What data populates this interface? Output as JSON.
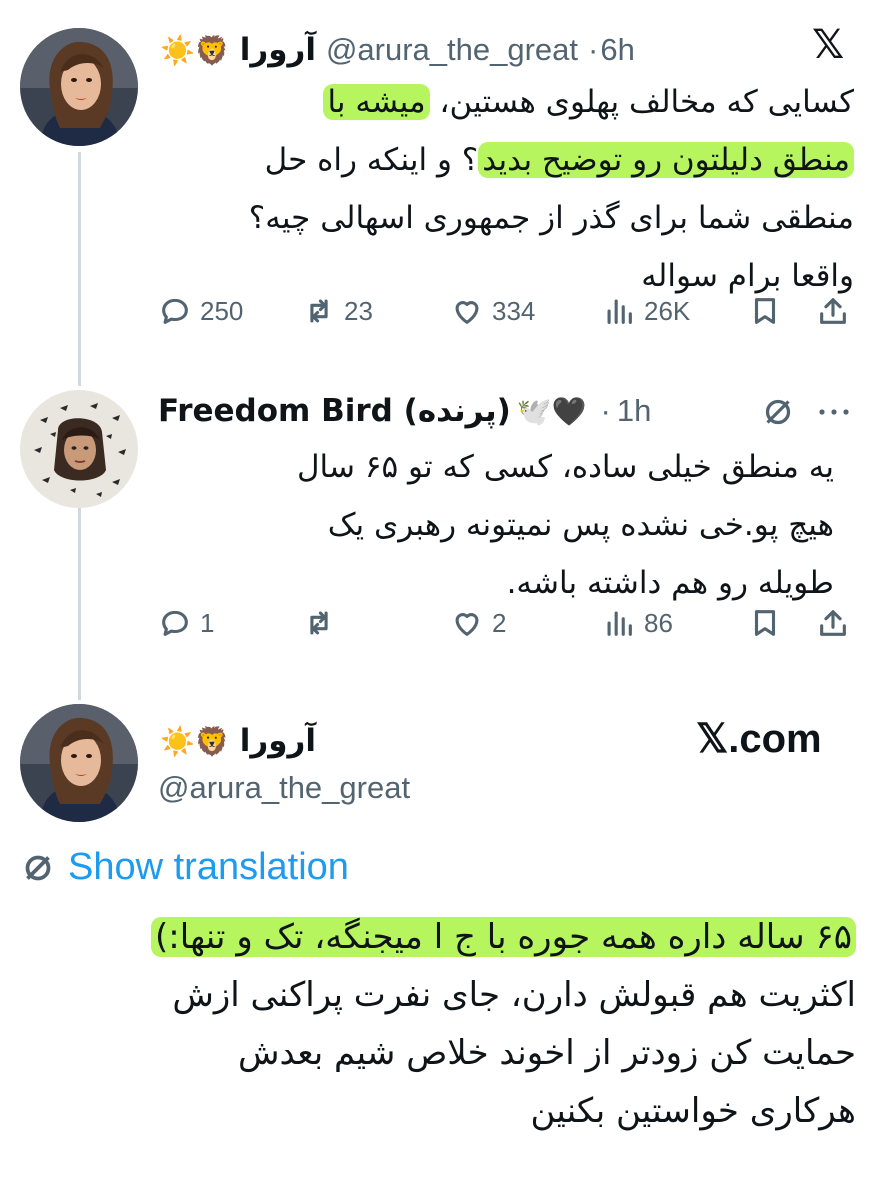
{
  "tweet1": {
    "display_name": "آرورا",
    "emojis": "☀️🦁",
    "handle": "@arura_the_great",
    "separator": "·",
    "time": "6h",
    "x_logo": "𝕏",
    "body_lines": [
      [
        "کسایی که مخالف پهلوی هستین، ",
        "میشه با"
      ],
      [
        "منطق دلیلتون رو توضیح بدید",
        "؟ و اینکه راه حل"
      ],
      [
        "منطقی شما برای گذر از جمهوری اسهالی چیه؟"
      ],
      [
        "واقعا برام سواله"
      ]
    ],
    "stats": {
      "replies": "250",
      "reposts": "23",
      "likes": "334",
      "views": "26K"
    }
  },
  "tweet2": {
    "display_name": "Freedom Bird (پرنده)",
    "emojis": "🕊️🖤",
    "separator": "·",
    "time": "1h",
    "body_lines": [
      "یه منطق خیلی ساده، کسی که تو ۶۵ سال",
      "هیچ پو.خی نشده پس نمیتونه رهبری یک",
      "طویله رو هم داشته باشه."
    ],
    "stats": {
      "replies": "1",
      "reposts": "",
      "likes": "2",
      "views": "86"
    }
  },
  "tweet3": {
    "display_name": "آرورا",
    "emojis": "☀️🦁",
    "handle": "@arura_the_great",
    "watermark": "𝕏.com",
    "translation_label": "Show translation",
    "body_lines": [
      "۶۵ ساله داره همه جوره با ج ا میجنگه، تک و تنها:)",
      "اکثریت هم قبولش دارن، جای نفرت پراکنی ازش",
      "حمایت کن زودتر از اخوند خلاص شیم بعدش",
      "هرکاری خواستین بکنین"
    ]
  },
  "colors": {
    "highlight": "#b7f55f",
    "link": "#1d9bf0",
    "muted": "#536471",
    "text": "#0f1419"
  }
}
